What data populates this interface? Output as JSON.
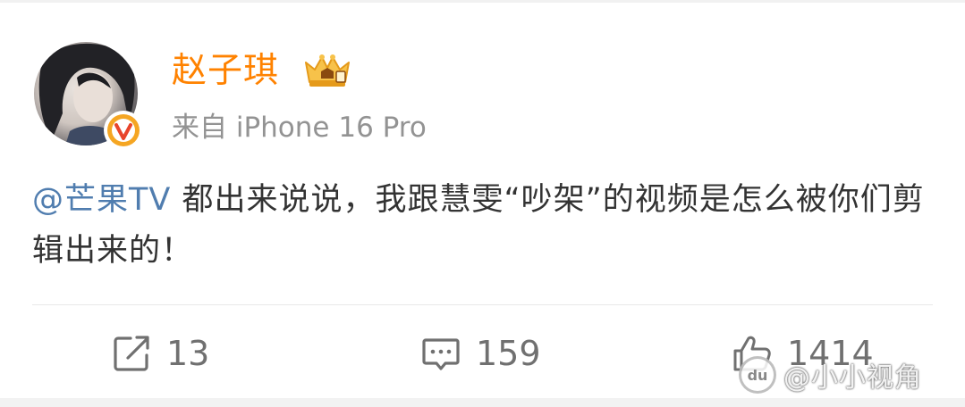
{
  "user": {
    "name": "赵子琪",
    "source": "来自 iPhone 16 Pro"
  },
  "post": {
    "mention": "@芒果TV",
    "text": " 都出来说说，我跟慧雯“吵架”的视频是怎么被你们剪辑出来的！"
  },
  "actions": {
    "repost_count": "13",
    "comment_count": "159",
    "like_count": "1414"
  },
  "icons": {
    "repost": "repost-icon",
    "comment": "comment-icon",
    "like": "like-icon",
    "verified": "verified-badge-icon",
    "member": "member-crown-icon"
  },
  "colors": {
    "username": "#ff8200",
    "mention": "#507daf",
    "body_text": "#333333",
    "meta_text": "#939393",
    "action_text": "#707070",
    "verified": "#f5a623"
  },
  "watermark": {
    "logo": "du",
    "text": "@小小视角"
  }
}
